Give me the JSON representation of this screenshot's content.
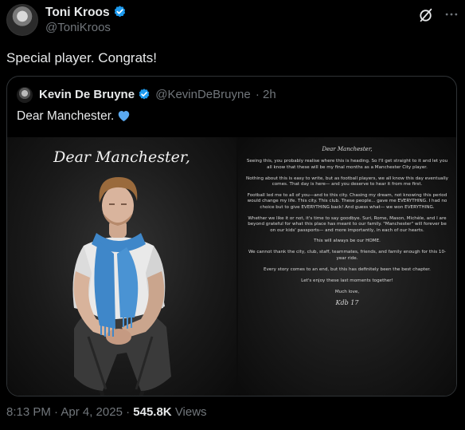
{
  "tweet": {
    "author_name": "Toni Kroos",
    "author_handle": "@ToniKroos",
    "text": "Special player. Congrats!",
    "timestamp": "8:13 PM · Apr 4, 2025",
    "separator": " · ",
    "views_count": "545.8K",
    "views_label": "Views"
  },
  "quoted_tweet": {
    "author_name": "Kevin De Bruyne",
    "author_handle": "@KevinDeBruyne",
    "age": "· 2h",
    "text": "Dear Manchester.",
    "image": {
      "left_title": "Dear Manchester,",
      "letter_heading": "Dear Manchester,",
      "paragraphs": [
        "Seeing this, you probably realise where this is heading. So I'll get straight to it and let you all know that these will be my final months as a Manchester City player.",
        "Nothing about this is easy to write, but as football players, we all know this day eventually comes. That day is here— and you deserve to hear it from me first.",
        "Football led me to all of you—and to this city. Chasing my dream, not knowing this period would change my life. This city. This club. These people... gave me EVERYTHING. I had no choice but to give EVERYTHING back! And guess what— we won EVERYTHING.",
        "Whether we like it or not, it's time to say goodbye. Suri, Rome, Mason, Michèle, and I are beyond grateful for what this place has meant to our family. \"Manchester\" will forever be on our kids' passports— and more importantly, in each of our hearts.",
        "This will always be our HOME.",
        "We cannot thank the city, club, staff, teammates, friends, and family enough for this 10-year ride.",
        "Every story comes to an end, but this has definitely been the best chapter.",
        "Let's enjoy these last moments together!",
        "Much love,"
      ],
      "signature": "Kdb 17"
    }
  },
  "colors": {
    "background": "#000000",
    "text_primary": "#e7e9ea",
    "text_secondary": "#71767b",
    "verified_blue": "#1d9bf0",
    "heart_blue": "#5aa9f0",
    "scarf_blue": "#3f87c9",
    "border": "#2f3336"
  },
  "icons": {
    "verified": "verified-badge-icon",
    "grok": "grok-icon",
    "heart": "blue-heart-icon"
  }
}
